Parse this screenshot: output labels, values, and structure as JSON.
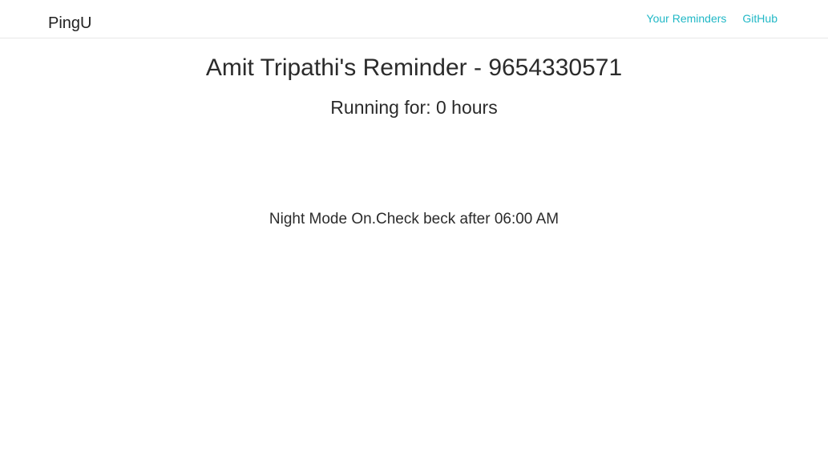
{
  "navbar": {
    "brand": "PingU",
    "links": [
      "Your Reminders",
      "GitHub"
    ],
    "link_color": "#21b8c6"
  },
  "main": {
    "title": "Amit Tripathi's Reminder - 9654330571",
    "running": "Running for: 0 hours",
    "night_mode": "Night Mode On.Check beck after 06:00 AM"
  }
}
